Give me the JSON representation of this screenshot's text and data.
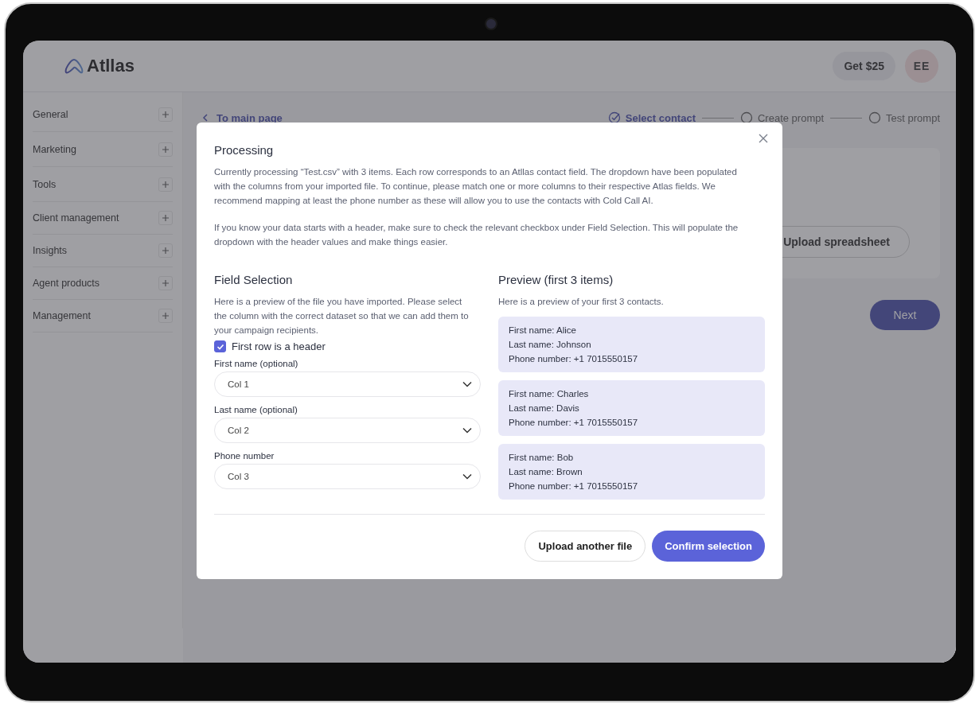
{
  "header": {
    "logo": "Atllas",
    "promo_button": "Get $25",
    "avatar": "EE"
  },
  "sidebar": {
    "items": [
      {
        "label": "General",
        "expanded": false
      },
      {
        "label": "Marketing",
        "expanded": false
      },
      {
        "label": "Tools",
        "expanded": false
      },
      {
        "label": "Client management",
        "expanded": false
      },
      {
        "label": "Insights",
        "expanded": false
      },
      {
        "label": "Agent products",
        "expanded": false
      },
      {
        "label": "Management",
        "expanded": false
      }
    ]
  },
  "page": {
    "back_link": "To main page",
    "steps": [
      {
        "label": "Select contact",
        "selected": true
      },
      {
        "label": "Create prompt",
        "selected": false
      },
      {
        "label": "Test prompt",
        "selected": false
      }
    ],
    "upload_button": "Upload spreadsheet",
    "next_button": "Next"
  },
  "modal": {
    "title": "Processing",
    "paragraphs": [
      "Currently processing “Test.csv” with 3 items. Each row corresponds to an Atllas contact field. The dropdown have been populated with the columns from your imported file. To continue, please match one or more columns to their respective Atlas fields. We recommend mapping at least the phone number as these will allow you to use the contacts with Cold Call AI.",
      "If you know your data starts with a header, make sure to check the relevant checkbox under Field Selection. This will populate the dropdown with the header values and make things easier."
    ],
    "field_selection": {
      "title": "Field Selection",
      "description": "Here is a preview of the file you have imported. Please select the column with the correct dataset so that we can add them to your campaign recipients.",
      "header_checkbox": {
        "label": "First row is a header",
        "checked": true
      },
      "fields": [
        {
          "label": "First name (optional)",
          "value": "Col 1"
        },
        {
          "label": "Last name (optional)",
          "value": "Col 2"
        },
        {
          "label": "Phone number",
          "value": "Col 3"
        }
      ]
    },
    "preview": {
      "title": "Preview (first 3 items)",
      "description": "Here is a preview of your first 3 contacts.",
      "contacts": [
        [
          "First name: Alice",
          "Last name: Johnson",
          "Phone number: +1 7015550157"
        ],
        [
          "First name: Charles",
          "Last name: Davis",
          "Phone number: +1 7015550157"
        ],
        [
          "First name: Bob",
          "Last name: Brown",
          "Phone number: +1 7015550157"
        ]
      ]
    },
    "buttons": [
      {
        "label": "Upload another file",
        "kind": "secondary"
      },
      {
        "label": "Confirm selection",
        "kind": "primary"
      }
    ]
  }
}
